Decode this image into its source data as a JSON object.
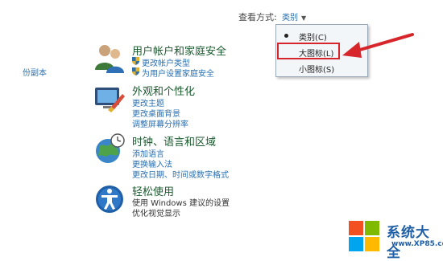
{
  "left_fragment": "份副本",
  "view_by": {
    "label": "查看方式:",
    "value": "类别"
  },
  "view_menu": {
    "items": [
      {
        "label": "类别(C)",
        "selected": true
      },
      {
        "label": "大图标(L)",
        "selected": false,
        "highlighted": true
      },
      {
        "label": "小图标(S)",
        "selected": false
      }
    ]
  },
  "categories": [
    {
      "title": "用户帐户和家庭安全",
      "icon": "users-icon",
      "links": [
        "更改帐户类型",
        "为用户设置家庭安全"
      ]
    },
    {
      "title": "外观和个性化",
      "icon": "appearance-icon",
      "links": [
        "更改主题",
        "更改桌面背景",
        "调整屏幕分辨率"
      ]
    },
    {
      "title": "时钟、语言和区域",
      "icon": "clock-globe-icon",
      "links": [
        "添加语言",
        "更换输入法",
        "更改日期、时间或数字格式"
      ]
    },
    {
      "title": "轻松使用",
      "icon": "accessibility-icon",
      "links": [
        "使用 Windows 建议的设置",
        "优化视觉显示"
      ]
    }
  ],
  "watermark": {
    "title": "系统大全",
    "url": "www.XP85.com"
  },
  "colors": {
    "highlight": "#d6262b",
    "link": "#2a6fb0",
    "category_title": "#1a5a2e"
  }
}
